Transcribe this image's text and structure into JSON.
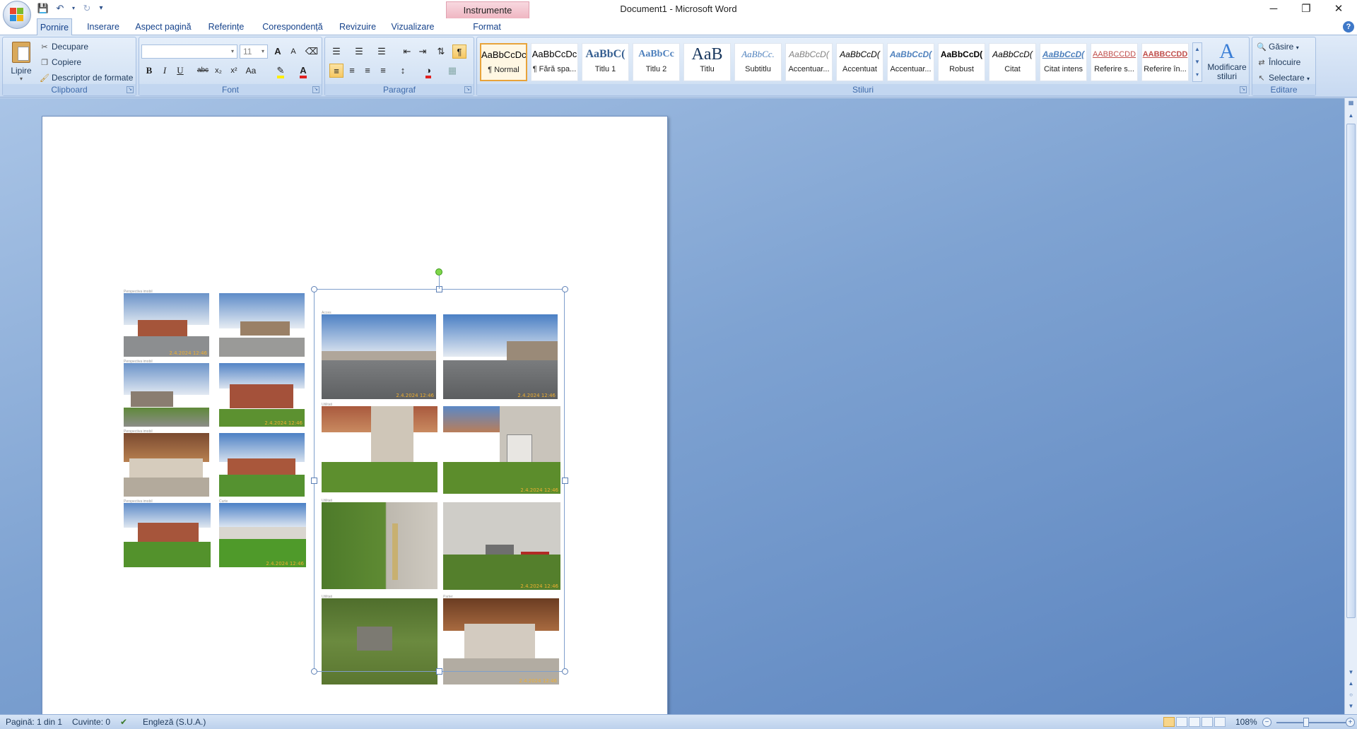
{
  "window": {
    "title": "Document1 - Microsoft Word",
    "context_tab": "Instrumente imagine",
    "minimize_icon": "─",
    "restore_icon": "❐",
    "close_icon": "✕"
  },
  "qat": {
    "customize": "▾"
  },
  "tabs": [
    {
      "label": "Pornire"
    },
    {
      "label": "Inserare"
    },
    {
      "label": "Aspect pagină"
    },
    {
      "label": "Referințe"
    },
    {
      "label": "Corespondență"
    },
    {
      "label": "Revizuire"
    },
    {
      "label": "Vizualizare"
    },
    {
      "label": "Format"
    }
  ],
  "ribbon": {
    "clipboard": {
      "label": "Clipboard",
      "paste": "Lipire",
      "cut": "Decupare",
      "copy": "Copiere",
      "format_painter": "Descriptor de formate"
    },
    "font": {
      "label": "Font",
      "font_name": "",
      "font_size": "11",
      "bold": "B",
      "italic": "I",
      "underline": "U",
      "strike": "abc",
      "subscript": "x₂",
      "superscript": "x²",
      "change_case": "Aa",
      "grow": "A",
      "shrink": "A"
    },
    "paragraph": {
      "label": "Paragraf",
      "show_marks": "¶"
    },
    "styles": {
      "label": "Stiluri",
      "items": [
        {
          "sample": "AaBbCcDc",
          "name": "¶ Normal"
        },
        {
          "sample": "AaBbCcDc",
          "name": "¶ Fără spa..."
        },
        {
          "sample": "AaBbC(",
          "name": "Titlu 1"
        },
        {
          "sample": "AaBbCc",
          "name": "Titlu 2"
        },
        {
          "sample": "AaB",
          "name": "Titlu"
        },
        {
          "sample": "AaBbCc.",
          "name": "Subtitlu"
        },
        {
          "sample": "AaBbCcD(",
          "name": "Accentuar..."
        },
        {
          "sample": "AaBbCcD(",
          "name": "Accentuat"
        },
        {
          "sample": "AaBbCcD(",
          "name": "Accentuar..."
        },
        {
          "sample": "AaBbCcD(",
          "name": "Robust"
        },
        {
          "sample": "AaBbCcD(",
          "name": "Citat"
        },
        {
          "sample": "AaBbCcD(",
          "name": "Citat intens"
        },
        {
          "sample": "AABBCCDD",
          "name": "Referire s..."
        },
        {
          "sample": "AABBCCDD",
          "name": "Referire în..."
        }
      ],
      "change_styles": "Modificare stiluri"
    },
    "editing": {
      "label": "Editare",
      "find": "Găsire",
      "replace": "Înlocuire",
      "select": "Selectare"
    }
  },
  "photos": {
    "stamp": "2.4.2024 12:46",
    "left_caption_1": "Perspectiva imobil",
    "left_caption_2": "Perspectiva imobil",
    "left_caption_3": "Perspectiva imobil",
    "left_caption_4": "Perspectiva imobil",
    "left_caption_5": "Curte",
    "right_caption_1": "Acces",
    "right_caption_2": "Utilitati",
    "right_caption_3": "Utilitati",
    "right_caption_4": "Utilitati",
    "right_caption_5": "Parter"
  },
  "status": {
    "page": "Pagină: 1 din 1",
    "words": "Cuvinte: 0",
    "language": "Engleză (S.U.A.)",
    "zoom": "108%"
  },
  "colors": {
    "accent": "#15428b",
    "ribbon": "#dbe7f6",
    "workspace": "#6a90c8",
    "stamp": "#f0b030"
  }
}
